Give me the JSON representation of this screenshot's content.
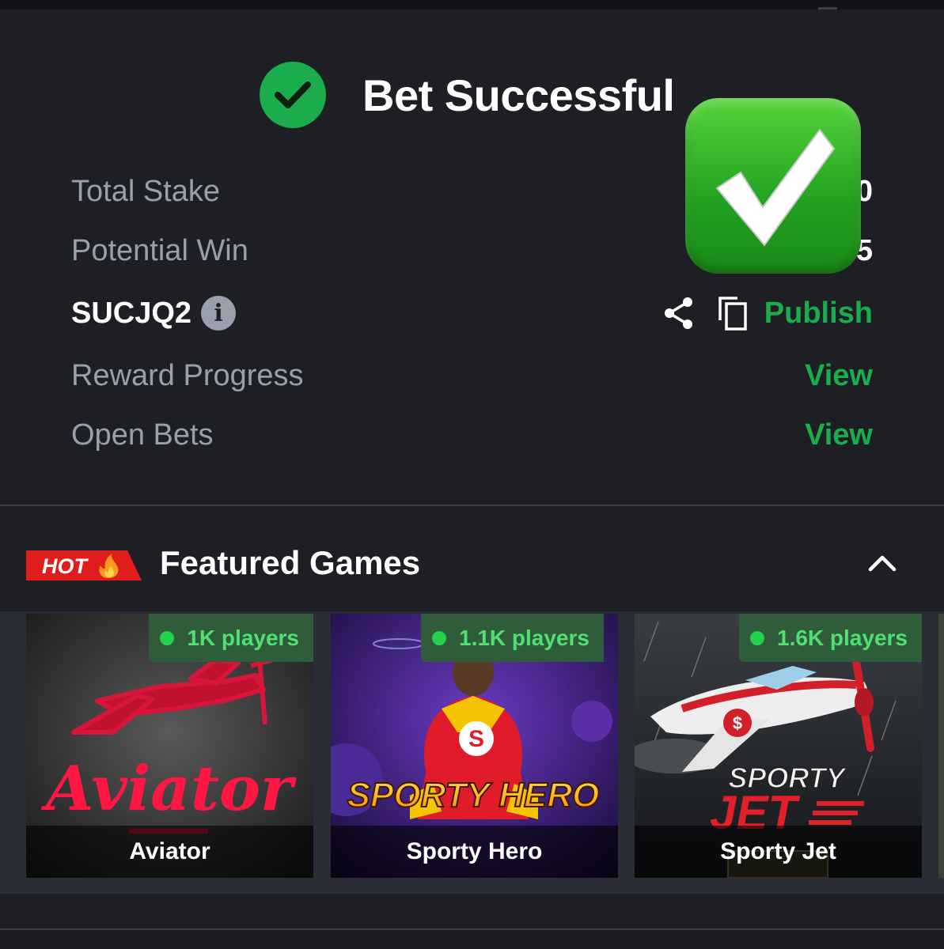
{
  "modal": {
    "title": "Bet Successful",
    "rows": {
      "total_stake_label": "Total Stake",
      "total_stake_value": "0",
      "potential_win_label": "Potential Win",
      "potential_win_value": "5",
      "booking_code": "SUCJQ2",
      "info_icon": "i",
      "publish_label": "Publish",
      "reward_progress_label": "Reward Progress",
      "reward_progress_action": "View",
      "open_bets_label": "Open Bets",
      "open_bets_action": "View"
    }
  },
  "featured": {
    "badge": "HOT",
    "title": "Featured Games",
    "games": [
      {
        "name": "Aviator",
        "players": "1K players",
        "art_text": "Aviator"
      },
      {
        "name": "Sporty Hero",
        "players": "1.1K players",
        "art_text": "SPORTY HERO"
      },
      {
        "name": "Sporty Jet",
        "players": "1.6K players",
        "art_text_top": "SPORTY",
        "art_text_bottom": "JET"
      }
    ]
  },
  "colors": {
    "background": "#1d1f25",
    "accent_green": "#1bad4c",
    "label_gray": "#9aa0ab",
    "hot_red": "#e01c1c"
  },
  "icons": {
    "success": "check-circle-icon",
    "share": "share-icon",
    "copy": "copy-icon",
    "collapse": "chevron-up-icon"
  }
}
